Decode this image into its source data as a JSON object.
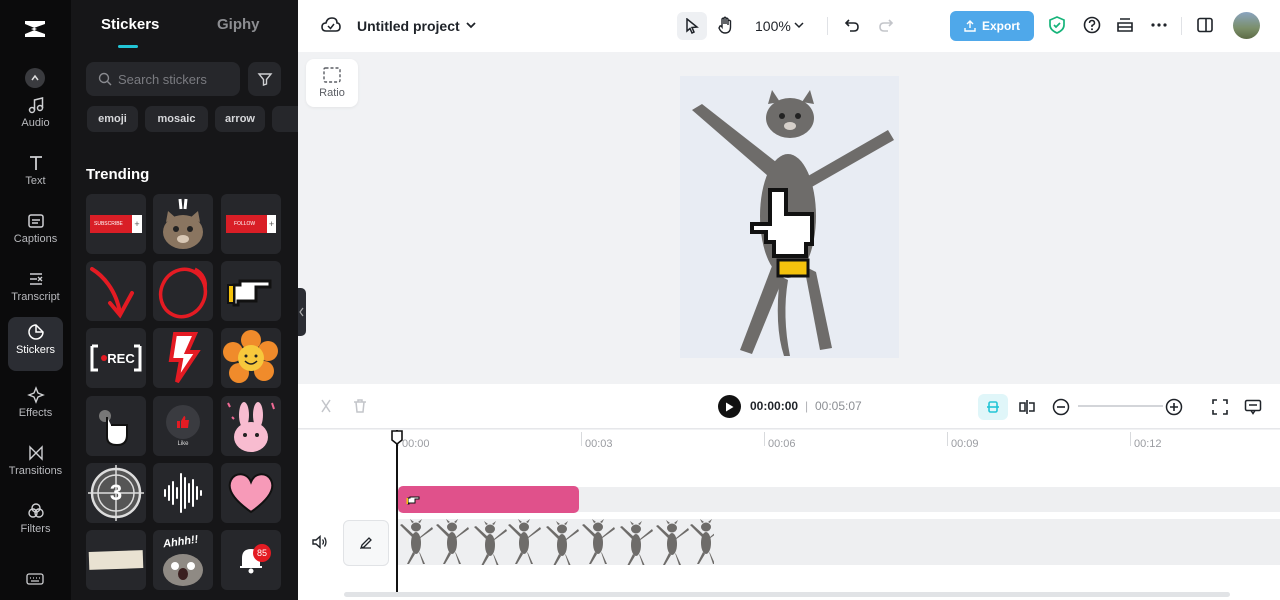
{
  "rail": {
    "items": [
      {
        "label": "Audio",
        "icon": "music-note-icon"
      },
      {
        "label": "Text",
        "icon": "text-icon"
      },
      {
        "label": "Captions",
        "icon": "captions-icon"
      },
      {
        "label": "Transcript",
        "icon": "transcript-icon"
      },
      {
        "label": "Stickers",
        "icon": "sticker-icon"
      },
      {
        "label": "Effects",
        "icon": "effects-icon"
      },
      {
        "label": "Transitions",
        "icon": "transitions-icon"
      },
      {
        "label": "Filters",
        "icon": "filters-icon"
      }
    ],
    "active": "Stickers"
  },
  "panel": {
    "tabs": {
      "stickers": "Stickers",
      "giphy": "Giphy"
    },
    "search_placeholder": "Search stickers",
    "chips": [
      "emoji",
      "mosaic",
      "arrow"
    ],
    "section_title": "Trending",
    "sticker_texts": {
      "subscribe": "SUBSCRIBE",
      "follow": "FOLLOW",
      "rec": "REC",
      "like": "Like",
      "countdown": "3",
      "ahhh": "Ahhh!!",
      "badge": "85"
    }
  },
  "topbar": {
    "project_title": "Untitled project",
    "zoom": "100%",
    "export_label": "Export"
  },
  "canvas": {
    "ratio_label": "Ratio"
  },
  "playback": {
    "current": "00:00:00",
    "separator": "|",
    "total": "00:05:07"
  },
  "timeline": {
    "ticks": [
      "00:00",
      "00:03",
      "00:06",
      "00:09",
      "00:12"
    ]
  },
  "colors": {
    "accent": "#22c5d6",
    "export": "#4fa8ea",
    "sticker_clip": "#e0518b",
    "rail_bg": "#0b0b0c",
    "panel_bg": "#161618"
  }
}
